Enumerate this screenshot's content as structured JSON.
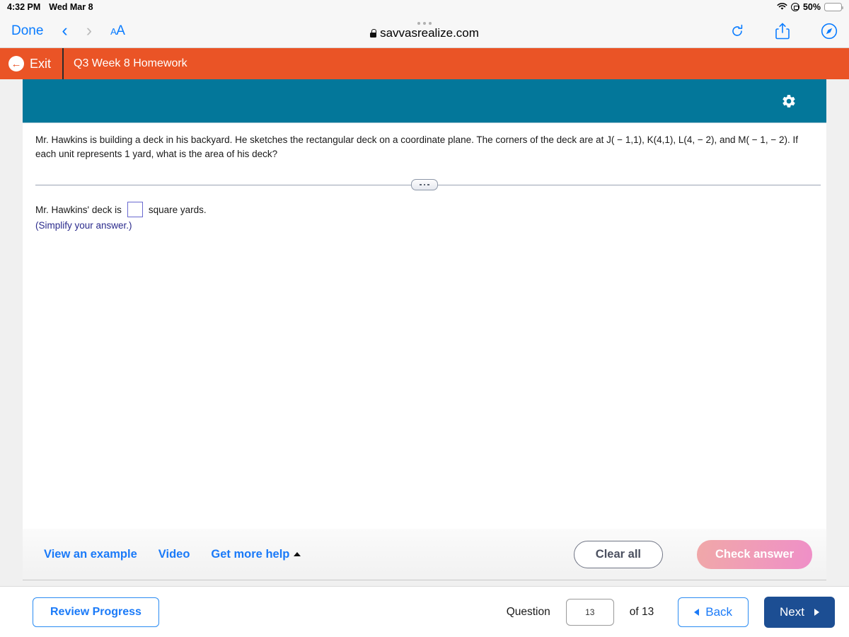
{
  "status_bar": {
    "time": "4:32 PM",
    "date": "Wed Mar 8",
    "wifi_icon": "wifi-icon",
    "rotation_lock_icon": "rotation-lock-icon",
    "battery_percent": "50%",
    "battery_level": 50,
    "battery_color": "#ffcc00"
  },
  "safari": {
    "done_label": "Done",
    "back_icon": "chevron-left-icon",
    "forward_icon": "chevron-right-icon",
    "text_size_label": "A",
    "text_size_small": "A",
    "url": "savvasrealize.com",
    "lock_icon": "lock-icon",
    "reload_icon": "reload-icon",
    "share_icon": "share-icon",
    "safari_icon": "compass-icon"
  },
  "app_bar": {
    "exit_label": "Exit",
    "exit_icon": "back-arrow-circle-icon",
    "assignment_title": "Q3 Week 8 Homework",
    "background_color": "#ea5426"
  },
  "card": {
    "header_color": "#03779a",
    "settings_icon": "gear-icon",
    "problem_text": "Mr. Hawkins is building a deck in his backyard. He sketches the rectangular deck on a coordinate plane. The corners of the deck are at J( − 1,1), K(4,1), L(4, − 2), and M( − 1, − 2). If each unit represents 1 yard, what is the area of his deck?",
    "divider_handle_icon": "drag-handle-dots-icon",
    "answer_prefix": "Mr. Hawkins' deck is",
    "answer_value": "",
    "answer_suffix": "square yards.",
    "simplify_note": "(Simplify your answer.)"
  },
  "help_bar": {
    "view_example_label": "View an example",
    "video_label": "Video",
    "get_more_help_label": "Get more help",
    "get_more_help_caret": "caret-up-icon",
    "clear_all_label": "Clear all",
    "check_answer_label": "Check answer",
    "check_answer_color": "#ef8fc8"
  },
  "footer": {
    "review_progress_label": "Review Progress",
    "question_label": "Question",
    "question_number": "13",
    "of_label": "of 13",
    "back_label": "Back",
    "back_icon": "triangle-left-icon",
    "next_label": "Next",
    "next_icon": "triangle-right-icon",
    "next_color": "#1c4e93"
  }
}
